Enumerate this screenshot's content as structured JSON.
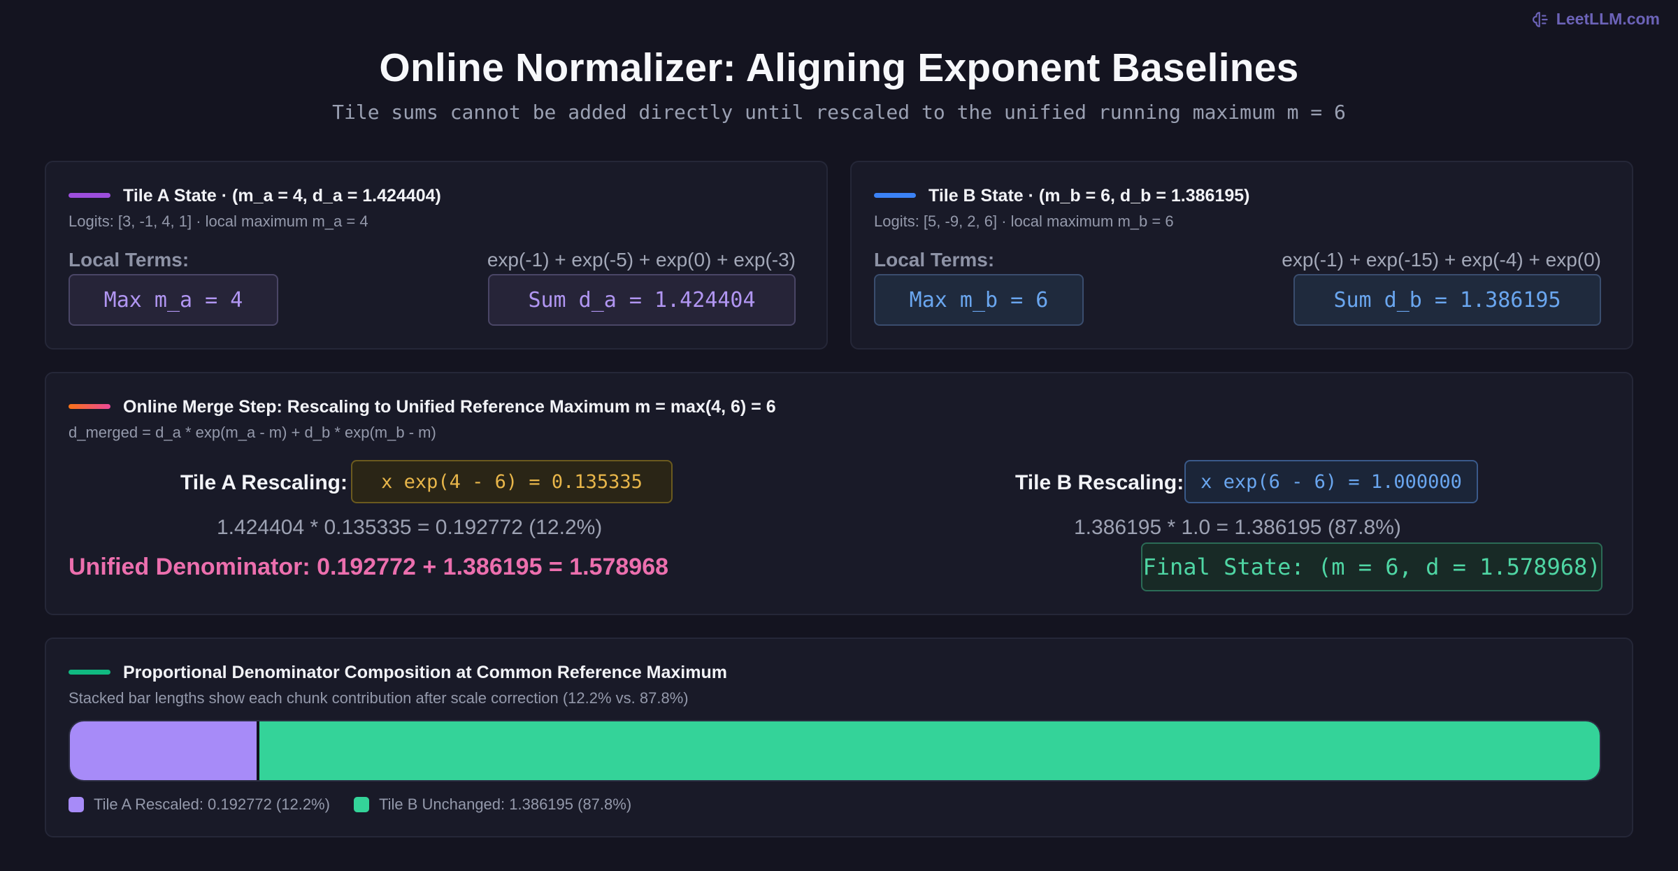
{
  "brand": {
    "text": "LeetLLM.com"
  },
  "header": {
    "title": "Online Normalizer: Aligning Exponent Baselines",
    "subtitle": "Tile sums cannot be added directly until rescaled to the unified running maximum m = 6"
  },
  "tile_a": {
    "title": "Tile A State · (m_a = 4, d_a = 1.424404)",
    "logits": "Logits: [3, -1, 4, 1] · local maximum m_a = 4",
    "local_terms_label": "Local Terms:",
    "expr": "exp(-1) + exp(-5) + exp(0) + exp(-3)",
    "max_box": "Max m_a = 4",
    "sum_box": "Sum d_a = 1.424404",
    "accent": "#9d4edd"
  },
  "tile_b": {
    "title": "Tile B State · (m_b = 6, d_b = 1.386195)",
    "logits": "Logits: [5, -9, 2, 6] · local maximum m_b = 6",
    "local_terms_label": "Local Terms:",
    "expr": "exp(-1) + exp(-15) + exp(-4) + exp(0)",
    "max_box": "Max m_b = 6",
    "sum_box": "Sum d_b = 1.386195",
    "accent": "#3b82f6"
  },
  "merge": {
    "title": "Online Merge Step: Rescaling to Unified Reference Maximum m = max(4, 6) = 6",
    "formula": "d_merged = d_a * exp(m_a - m) + d_b * exp(m_b - m)",
    "a_label": "Tile A Rescaling:",
    "a_factor": "x exp(4 - 6) = 0.135335",
    "a_calc": "1.424404 * 0.135335 = 0.192772 (12.2%)",
    "b_label": "Tile B Rescaling:",
    "b_factor": "x exp(6 - 6) = 1.000000",
    "b_calc": "1.386195 * 1.0 = 1.386195 (87.8%)",
    "unified": "Unified Denominator: 0.192772 + 1.386195 = 1.578968",
    "final_state": "Final State: (m = 6, d = 1.578968)"
  },
  "composition": {
    "title": "Proportional Denominator Composition at Common Reference Maximum",
    "subtitle": "Stacked bar lengths show each chunk contribution after scale correction (12.2% vs. 87.8%)",
    "segments": [
      {
        "label": "Tile A Rescaled: 0.192772 (12.2%)",
        "value": 0.192772,
        "color": "#a78bf8"
      },
      {
        "label": "Tile B Unchanged: 1.386195 (87.8%)",
        "value": 1.386195,
        "color": "#34d399"
      }
    ]
  }
}
